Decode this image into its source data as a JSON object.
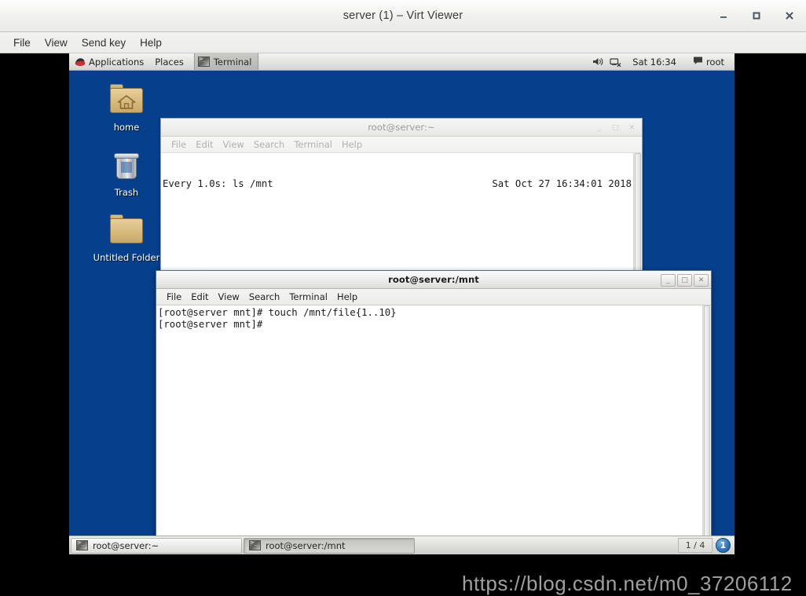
{
  "viewer": {
    "title": "server (1) – Virt Viewer",
    "controls": [
      {
        "name": "minimize-button",
        "glyph": "minimize"
      },
      {
        "name": "maximize-button",
        "glyph": "maximize"
      },
      {
        "name": "close-button",
        "glyph": "close"
      }
    ],
    "menu": [
      "File",
      "View",
      "Send key",
      "Help"
    ]
  },
  "guest": {
    "top_panel": {
      "applications_label": "Applications",
      "places_label": "Places",
      "window_tab_label": "Terminal",
      "clock": "Sat 16:34",
      "user": "root",
      "tray": [
        "volume-icon",
        "network-icon"
      ]
    },
    "desktop_icons": [
      {
        "label": "home",
        "icon": "home-folder-icon"
      },
      {
        "label": "Trash",
        "icon": "trash-icon"
      },
      {
        "label": "Untitled Folder",
        "icon": "folder-icon"
      }
    ],
    "windows": [
      {
        "id": "watch-window",
        "title": "root@server:~",
        "active": false,
        "menu": [
          "File",
          "Edit",
          "View",
          "Search",
          "Terminal",
          "Help"
        ],
        "watch_left": "Every 1.0s: ls /mnt",
        "watch_right": "Sat Oct 27 16:34:01 2018",
        "body_lines": []
      },
      {
        "id": "mnt-window",
        "title": "root@server:/mnt",
        "active": true,
        "menu": [
          "File",
          "Edit",
          "View",
          "Search",
          "Terminal",
          "Help"
        ],
        "body_lines": [
          "[root@server mnt]# touch /mnt/file{1..10}",
          "[root@server mnt]#"
        ]
      }
    ],
    "taskbar": {
      "buttons": [
        {
          "label": "root@server:~",
          "pressed": false
        },
        {
          "label": "root@server:/mnt",
          "pressed": true
        }
      ],
      "workspace": "1 / 4",
      "notification_count": "1"
    }
  },
  "watermark": "https://blog.csdn.net/m0_37206112",
  "colors": {
    "desktop_blue": "#06408c",
    "panel_grey": "#e3e3e0",
    "accent_badge": "#2f74bb"
  }
}
